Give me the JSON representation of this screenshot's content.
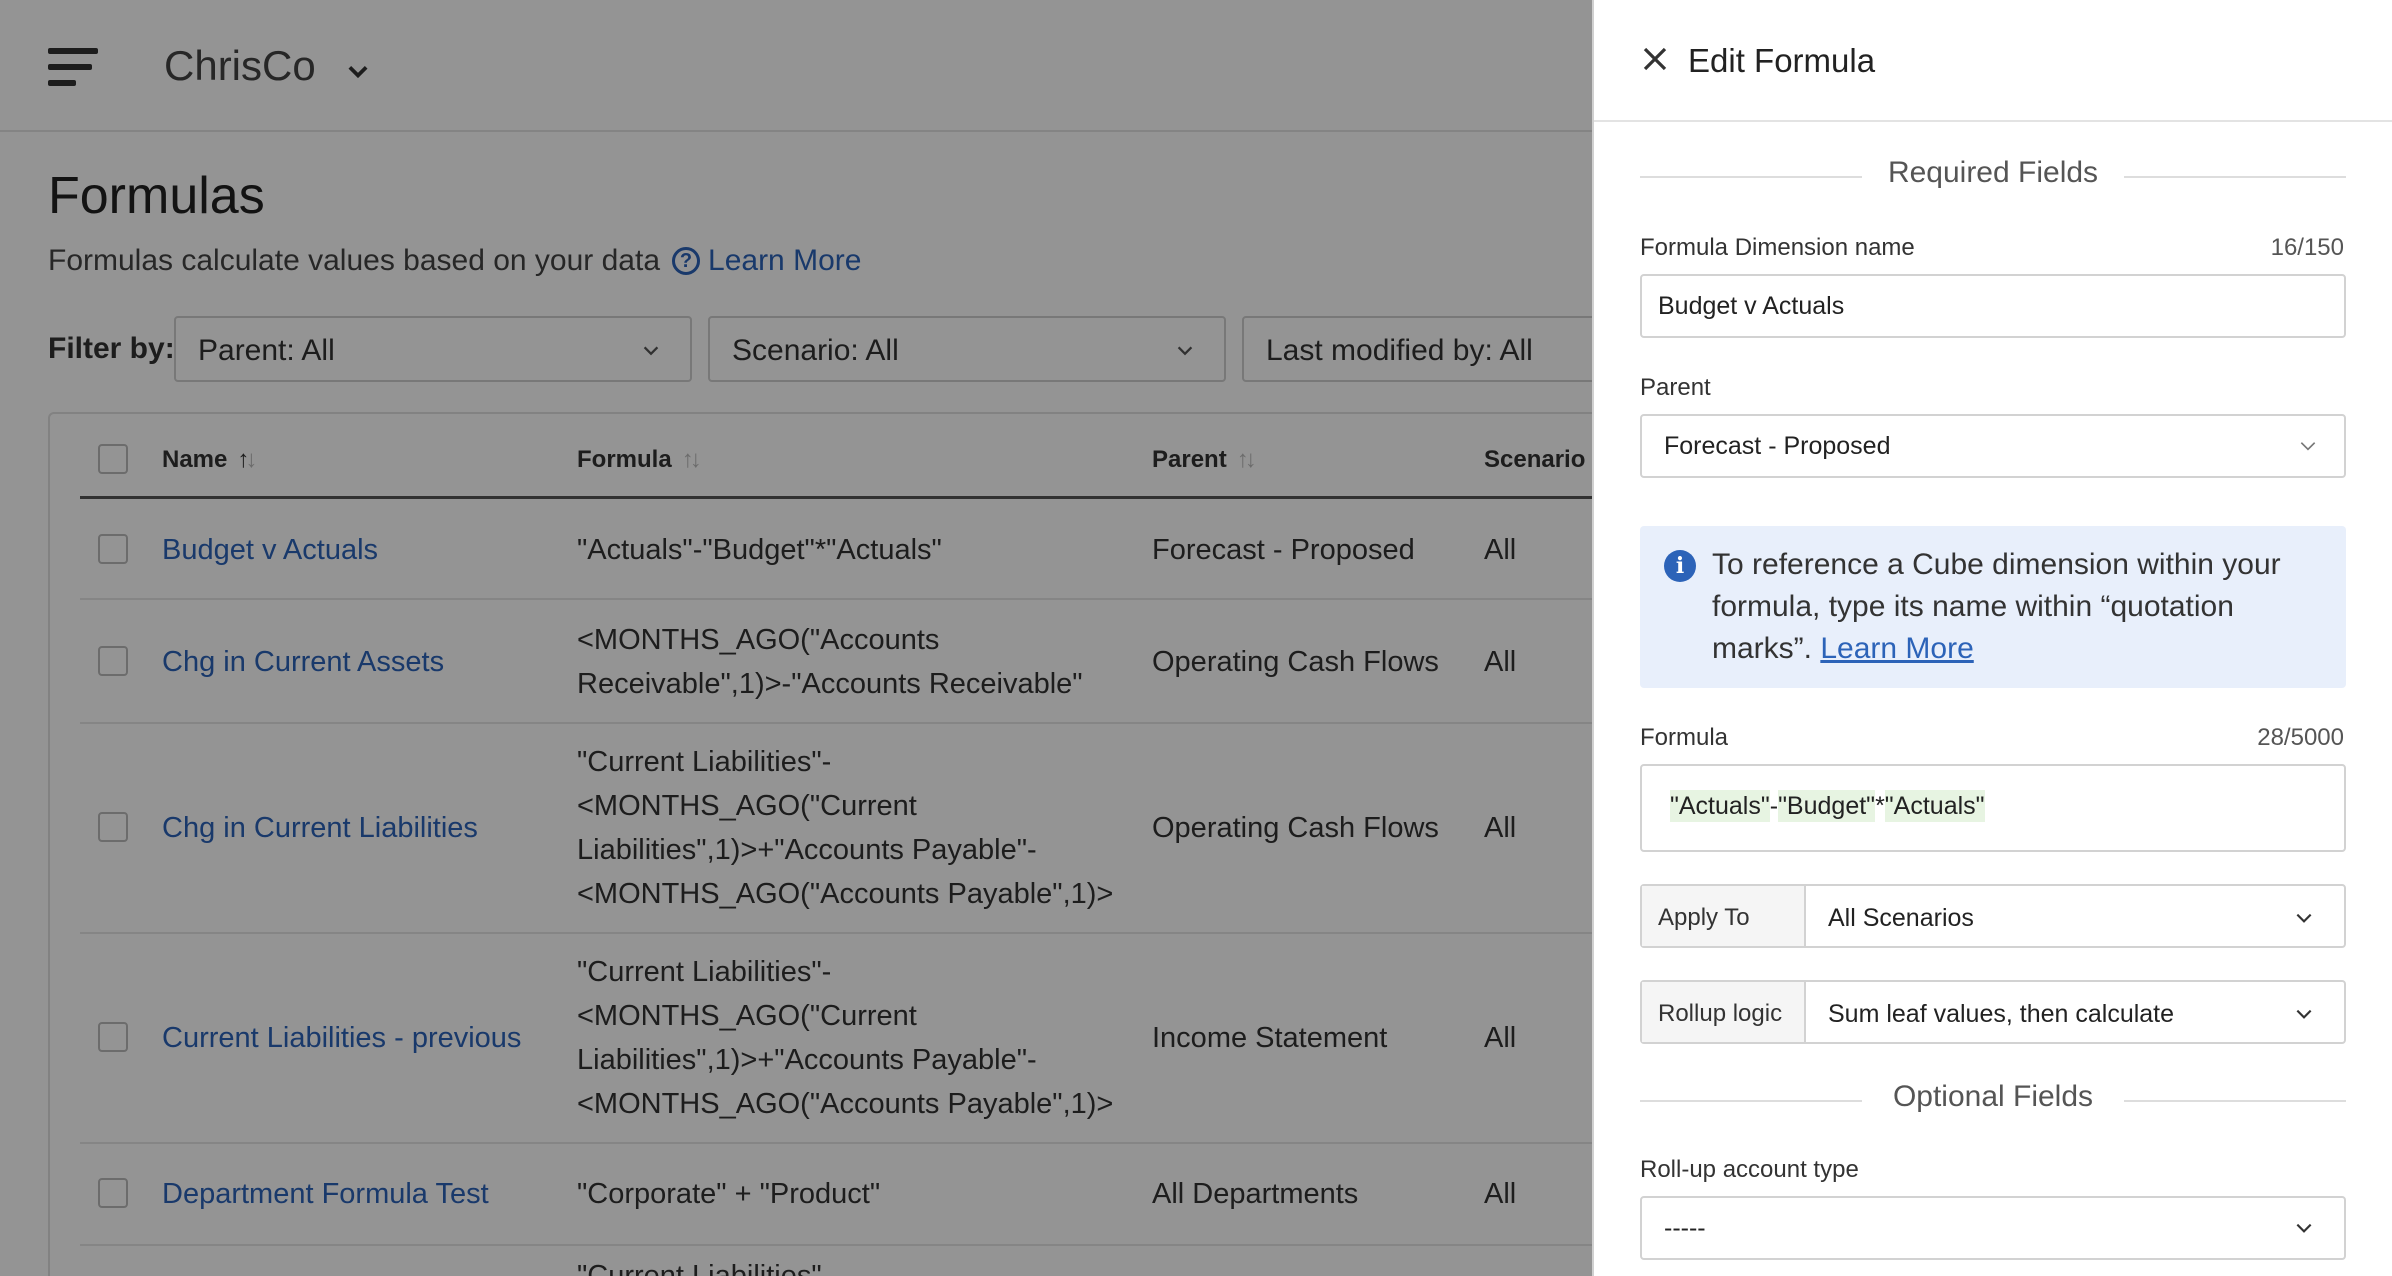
{
  "header": {
    "company": "ChrisCo"
  },
  "page": {
    "title": "Formulas",
    "subtitle": "Formulas calculate values based on your data",
    "learn_more": "Learn More"
  },
  "filters": {
    "label": "Filter by:",
    "parent": "Parent: All",
    "scenario": "Scenario: All",
    "modified": "Last modified by: All"
  },
  "table": {
    "headers": {
      "name": "Name",
      "formula": "Formula",
      "parent": "Parent",
      "scenario": "Scenario"
    },
    "rows": [
      {
        "name": "Budget v Actuals",
        "formula": "\"Actuals\"-\"Budget\"*\"Actuals\"",
        "parent": "Forecast - Proposed",
        "scenario": "All"
      },
      {
        "name": "Chg in Current Assets",
        "formula": "<MONTHS_AGO(\"Accounts\nReceivable\",1)>-\"Accounts Receivable\"",
        "parent": "Operating Cash Flows",
        "scenario": "All"
      },
      {
        "name": "Chg in Current Liabilities",
        "formula": "\"Current Liabilities\"-\n<MONTHS_AGO(\"Current\nLiabilities\",1)>+\"Accounts Payable\"-\n<MONTHS_AGO(\"Accounts Payable\",1)>",
        "parent": "Operating Cash Flows",
        "scenario": "All"
      },
      {
        "name": "Current Liabilities - previous",
        "formula": "\"Current Liabilities\"-\n<MONTHS_AGO(\"Current\nLiabilities\",1)>+\"Accounts Payable\"-\n<MONTHS_AGO(\"Accounts Payable\",1)>",
        "parent": "Income Statement",
        "scenario": "All"
      },
      {
        "name": "Department Formula Test",
        "formula": "\"Corporate\" + \"Product\"",
        "parent": "All Departments",
        "scenario": "All"
      },
      {
        "name": "",
        "formula": "\"Current Liabilities\"-",
        "parent": "",
        "scenario": ""
      }
    ]
  },
  "drawer": {
    "title": "Edit Formula",
    "required_title": "Required Fields",
    "name_label": "Formula Dimension name",
    "name_count": "16/150",
    "name_value": "Budget v Actuals",
    "parent_label": "Parent",
    "parent_value": "Forecast - Proposed",
    "info_text": "To reference a Cube dimension within your formula, type its name within “quotation marks”.",
    "info_link": "Learn More",
    "formula_label": "Formula",
    "formula_count": "28/5000",
    "formula_tokens": [
      "\"Actuals\"",
      "-",
      "\"Budget\"",
      "*",
      "\"Actuals\""
    ],
    "apply_label": "Apply To",
    "apply_value": "All Scenarios",
    "rollup_label": "Rollup logic",
    "rollup_value": "Sum leaf values, then calculate",
    "optional_title": "Optional Fields",
    "rollup_type_label": "Roll-up account type",
    "rollup_type_value": "-----"
  },
  "colors": {
    "link": "#2c63b8",
    "info_bg": "#e8effb",
    "overlay": "rgba(0,0,0,0.42)"
  }
}
